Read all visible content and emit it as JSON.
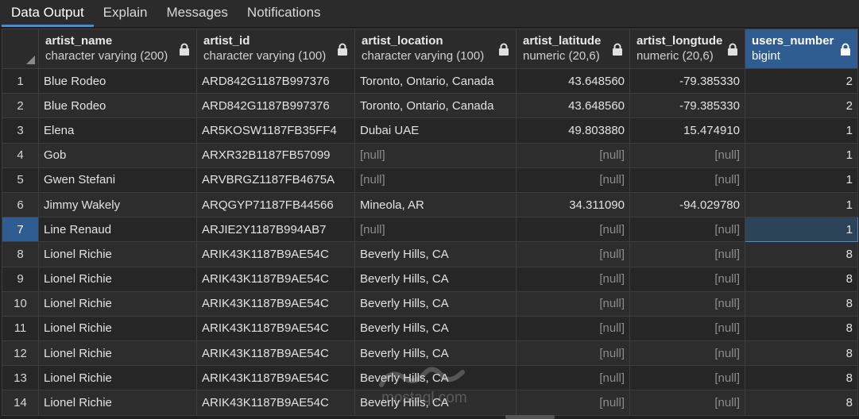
{
  "tabs": [
    {
      "label": "Data Output",
      "active": true
    },
    {
      "label": "Explain",
      "active": false
    },
    {
      "label": "Messages",
      "active": false
    },
    {
      "label": "Notifications",
      "active": false
    }
  ],
  "columns": [
    {
      "name": "artist_name",
      "type": "character varying (200)"
    },
    {
      "name": "artist_id",
      "type": "character varying (100)"
    },
    {
      "name": "artist_location",
      "type": "character varying (100)"
    },
    {
      "name": "artist_latitude",
      "type": "numeric (20,6)"
    },
    {
      "name": "artist_longtude",
      "type": "numeric (20,6)"
    },
    {
      "name": "users_number",
      "type": "bigint"
    }
  ],
  "null_text": "[null]",
  "rows": [
    {
      "n": "1",
      "artist_name": "Blue Rodeo",
      "artist_id": "ARD842G1187B997376",
      "artist_location": "Toronto, Ontario, Canada",
      "artist_latitude": "43.648560",
      "artist_longtude": "-79.385330",
      "users_number": "2"
    },
    {
      "n": "2",
      "artist_name": "Blue Rodeo",
      "artist_id": "ARD842G1187B997376",
      "artist_location": "Toronto, Ontario, Canada",
      "artist_latitude": "43.648560",
      "artist_longtude": "-79.385330",
      "users_number": "2"
    },
    {
      "n": "3",
      "artist_name": "Elena",
      "artist_id": "AR5KOSW1187FB35FF4",
      "artist_location": "Dubai UAE",
      "artist_latitude": "49.803880",
      "artist_longtude": "15.474910",
      "users_number": "1"
    },
    {
      "n": "4",
      "artist_name": "Gob",
      "artist_id": "ARXR32B1187FB57099",
      "artist_location": null,
      "artist_latitude": null,
      "artist_longtude": null,
      "users_number": "1"
    },
    {
      "n": "5",
      "artist_name": "Gwen Stefani",
      "artist_id": "ARVBRGZ1187FB4675A",
      "artist_location": null,
      "artist_latitude": null,
      "artist_longtude": null,
      "users_number": "1"
    },
    {
      "n": "6",
      "artist_name": "Jimmy Wakely",
      "artist_id": "ARQGYP71187FB44566",
      "artist_location": "Mineola, AR",
      "artist_latitude": "34.311090",
      "artist_longtude": "-94.029780",
      "users_number": "1"
    },
    {
      "n": "7",
      "artist_name": "Line Renaud",
      "artist_id": "ARJIE2Y1187B994AB7",
      "artist_location": null,
      "artist_latitude": null,
      "artist_longtude": null,
      "users_number": "1"
    },
    {
      "n": "8",
      "artist_name": "Lionel Richie",
      "artist_id": "ARIK43K1187B9AE54C",
      "artist_location": "Beverly Hills, CA",
      "artist_latitude": null,
      "artist_longtude": null,
      "users_number": "8"
    },
    {
      "n": "9",
      "artist_name": "Lionel Richie",
      "artist_id": "ARIK43K1187B9AE54C",
      "artist_location": "Beverly Hills, CA",
      "artist_latitude": null,
      "artist_longtude": null,
      "users_number": "8"
    },
    {
      "n": "10",
      "artist_name": "Lionel Richie",
      "artist_id": "ARIK43K1187B9AE54C",
      "artist_location": "Beverly Hills, CA",
      "artist_latitude": null,
      "artist_longtude": null,
      "users_number": "8"
    },
    {
      "n": "11",
      "artist_name": "Lionel Richie",
      "artist_id": "ARIK43K1187B9AE54C",
      "artist_location": "Beverly Hills, CA",
      "artist_latitude": null,
      "artist_longtude": null,
      "users_number": "8"
    },
    {
      "n": "12",
      "artist_name": "Lionel Richie",
      "artist_id": "ARIK43K1187B9AE54C",
      "artist_location": "Beverly Hills, CA",
      "artist_latitude": null,
      "artist_longtude": null,
      "users_number": "8"
    },
    {
      "n": "13",
      "artist_name": "Lionel Richie",
      "artist_id": "ARIK43K1187B9AE54C",
      "artist_location": "Beverly Hills, CA",
      "artist_latitude": null,
      "artist_longtude": null,
      "users_number": "8"
    },
    {
      "n": "14",
      "artist_name": "Lionel Richie",
      "artist_id": "ARIK43K1187B9AE54C",
      "artist_location": "Beverly Hills, CA",
      "artist_latitude": null,
      "artist_longtude": null,
      "users_number": "8"
    }
  ],
  "selected": {
    "row": 7,
    "column": "users_number"
  },
  "watermark": {
    "text": "mostaql.com"
  },
  "colors": {
    "accent": "#4c8ad6",
    "selected_header": "#2f5d91",
    "background": "#222222"
  }
}
